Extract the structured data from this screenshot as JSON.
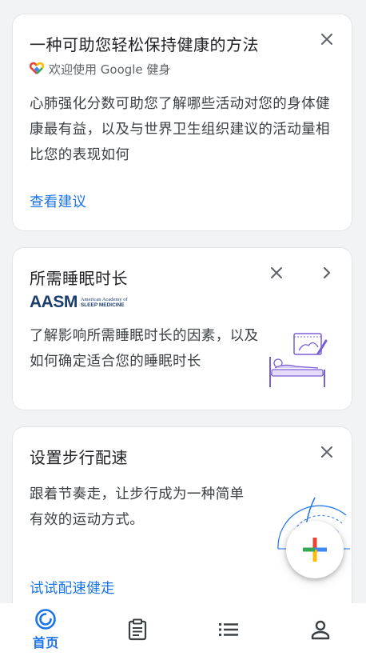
{
  "cards": {
    "intro": {
      "title": "一种可助您轻松保持健康的方法",
      "subtitle": "欢迎使用 Google 健身",
      "body": "心肺强化分数可助您了解哪些活动对您的身体健康最有益，以及与世界卫生组织建议的活动量相比您的表现如何",
      "link": "查看建议"
    },
    "sleep": {
      "title": "所需睡眠时长",
      "partner_logo": "AASM",
      "partner_sub_1": "American Academy of",
      "partner_sub_2": "SLEEP MEDICINE",
      "body": "了解影响所需睡眠时长的因素，以及如何确定适合您的睡眠时长"
    },
    "pace": {
      "title": "设置步行配速",
      "body": "跟着节奏走，让步行成为一种简单有效的运动方式。",
      "link": "试试配速健走"
    }
  },
  "bottom_nav": {
    "home_label": "首页",
    "items": [
      "home-icon",
      "journal-icon",
      "browse-icon",
      "profile-icon"
    ]
  },
  "colors": {
    "accent": "#1a73e8",
    "background": "#f1f3f4",
    "card": "#ffffff",
    "illustration_purple": "#7b5fd6"
  }
}
